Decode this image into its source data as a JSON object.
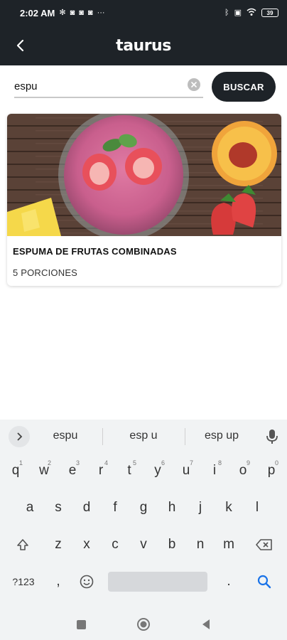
{
  "status_bar": {
    "time": "2:02 AM",
    "icons_left": [
      "gear-icon",
      "discord-icon",
      "discord-icon",
      "discord-icon",
      "more-icon"
    ],
    "icons_right": [
      "bluetooth-icon",
      "sim-icon",
      "wifi-icon",
      "battery-icon"
    ],
    "battery_level": "39"
  },
  "app_bar": {
    "logo": "taurus",
    "back_icon": "chevron-left-icon"
  },
  "search": {
    "value": "espu",
    "clear_icon": "clear-icon",
    "button_label": "BUSCAR"
  },
  "results": [
    {
      "title": "ESPUMA DE FRUTAS COMBINADAS",
      "servings": "5 PORCIONES"
    }
  ],
  "keyboard": {
    "suggestions": [
      "espu",
      "esp u",
      "esp up"
    ],
    "row1": [
      {
        "key": "q",
        "num": "1"
      },
      {
        "key": "w",
        "num": "2"
      },
      {
        "key": "e",
        "num": "3"
      },
      {
        "key": "r",
        "num": "4"
      },
      {
        "key": "t",
        "num": "5"
      },
      {
        "key": "y",
        "num": "6"
      },
      {
        "key": "u",
        "num": "7"
      },
      {
        "key": "i",
        "num": "8"
      },
      {
        "key": "o",
        "num": "9"
      },
      {
        "key": "p",
        "num": "0"
      }
    ],
    "row2": [
      "a",
      "s",
      "d",
      "f",
      "g",
      "h",
      "j",
      "k",
      "l"
    ],
    "row3": [
      "z",
      "x",
      "c",
      "v",
      "b",
      "n",
      "m"
    ],
    "symbols_label": "?123",
    "comma": ",",
    "period": "."
  },
  "colors": {
    "app_bar": "#1e2328",
    "button": "#1e2328",
    "keyboard_bg": "#f1f3f4",
    "search_key": "#1a73e8"
  }
}
